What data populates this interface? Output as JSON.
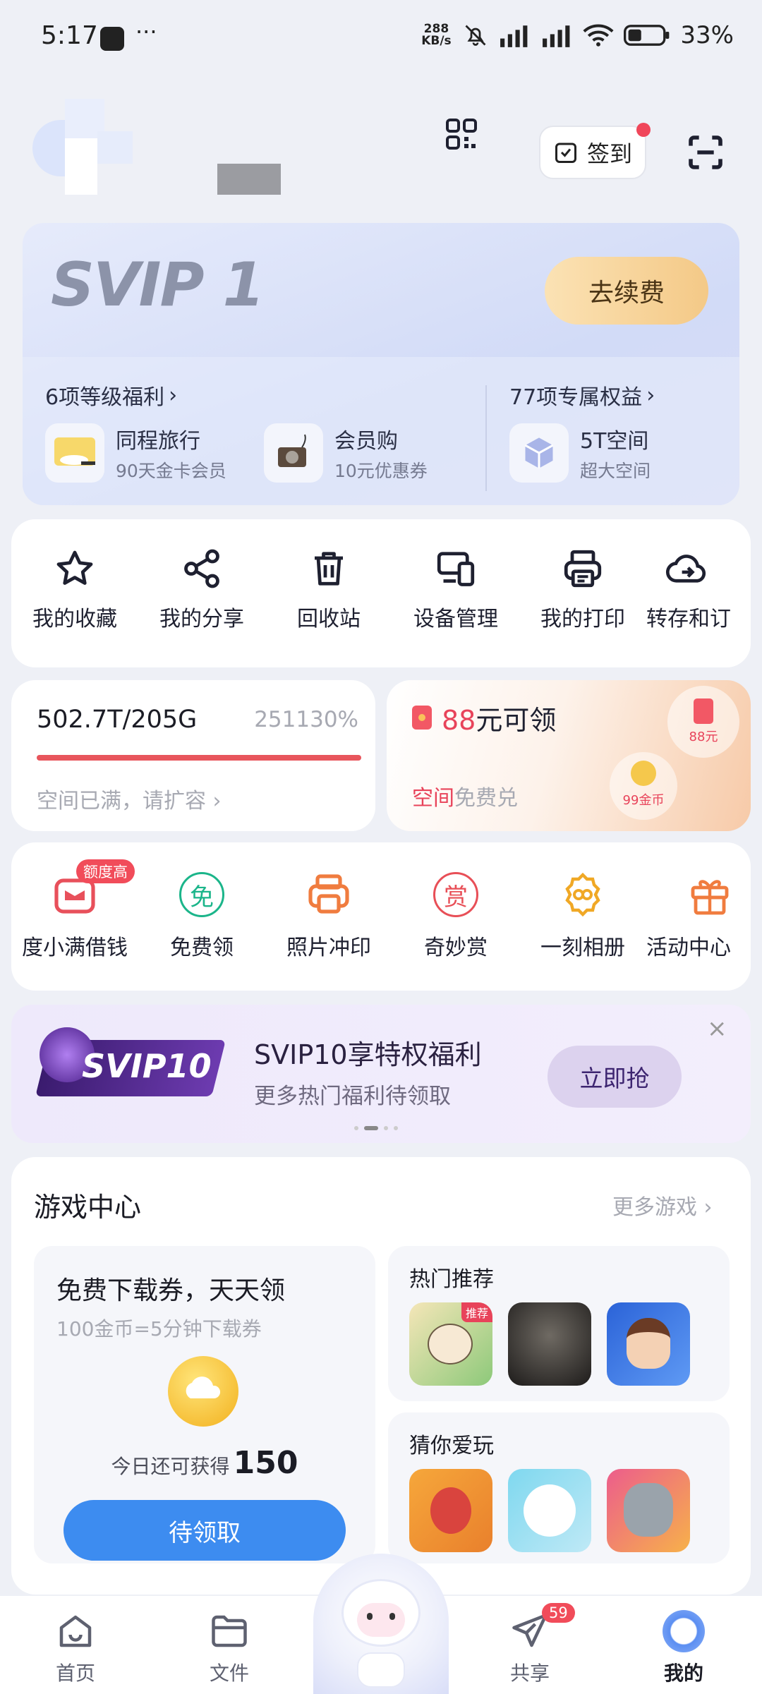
{
  "status": {
    "time": "5:17",
    "more": "···",
    "net_speed": "288 KB/s",
    "battery": "33%"
  },
  "header": {
    "checkin_label": "签到"
  },
  "svip": {
    "level": "SVIP 1",
    "renew_label": "去续费",
    "benefits_link": "6项等级福利",
    "rights_link": "77项专属权益",
    "items": [
      {
        "title": "同程旅行",
        "sub": "90天金卡会员"
      },
      {
        "title": "会员购",
        "sub": "10元优惠券"
      },
      {
        "title": "5T空间",
        "sub": "超大空间"
      }
    ]
  },
  "tools": [
    {
      "label": "我的收藏",
      "icon": "star-icon"
    },
    {
      "label": "我的分享",
      "icon": "share-icon"
    },
    {
      "label": "回收站",
      "icon": "trash-icon"
    },
    {
      "label": "设备管理",
      "icon": "device-icon"
    },
    {
      "label": "我的打印",
      "icon": "printer-icon"
    },
    {
      "label": "转存和订",
      "icon": "cloud-upload-icon"
    }
  ],
  "storage": {
    "usage": "502.7T/205G",
    "percent": "251130%",
    "note": "空间已满，请扩容",
    "fill_fraction": 1.0
  },
  "promo": {
    "amount": "88",
    "suffix": "元可领",
    "note_red": "空间",
    "note_grey": "免费兑",
    "coin1": "88元",
    "coin2": "99金币"
  },
  "services": [
    {
      "label": "度小满借钱",
      "icon": "wallet-icon",
      "badge": "额度高",
      "color": "#e8505b"
    },
    {
      "label": "免费领",
      "icon": "free-icon",
      "glyph": "免",
      "color": "#1bb58a"
    },
    {
      "label": "照片冲印",
      "icon": "photo-print-icon",
      "color": "#f07c3f"
    },
    {
      "label": "奇妙赏",
      "icon": "reward-icon",
      "glyph": "赏",
      "color": "#e84f57"
    },
    {
      "label": "一刻相册",
      "icon": "album-icon",
      "color": "#f0a825"
    },
    {
      "label": "活动中心",
      "icon": "gift-icon",
      "color": "#f07c3f"
    }
  ],
  "banner": {
    "badge_text": "SVIP10",
    "title": "SVIP10享特权福利",
    "subtitle": "更多热门福利待领取",
    "cta": "立即抢"
  },
  "game": {
    "title": "游戏中心",
    "more": "更多游戏",
    "voucher_title": "免费下载券，天天领",
    "voucher_sub": "100金币=5分钟下载券",
    "today_label": "今日还可获得",
    "today_value": "150",
    "claim_label": "待领取",
    "hot_title": "热门推荐",
    "hot_tag": "推荐",
    "guess_title": "猜你爱玩"
  },
  "nav": [
    {
      "label": "首页"
    },
    {
      "label": "文件"
    },
    {
      "label": "共享",
      "badge": "59"
    },
    {
      "label": "我的"
    }
  ]
}
